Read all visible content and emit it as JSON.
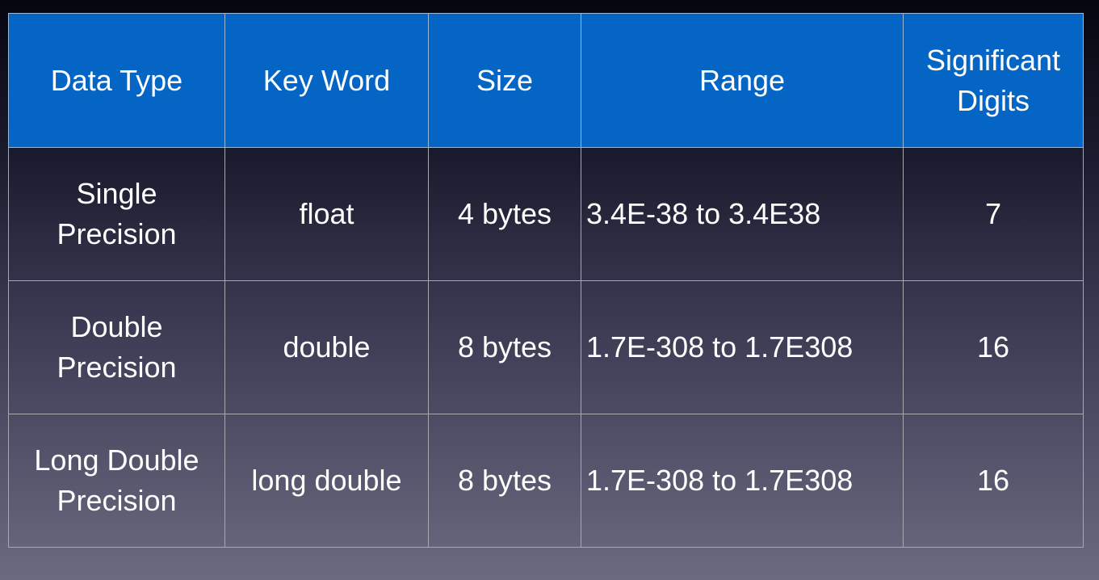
{
  "table": {
    "headers": [
      "Data Type",
      "Key Word",
      "Size",
      "Range",
      "Significant\nDigits"
    ],
    "rows": [
      [
        "Single\nPrecision",
        "float",
        "4 bytes",
        "3.4E-38 to 3.4E38",
        "7"
      ],
      [
        "Double\nPrecision",
        "double",
        "8 bytes",
        "1.7E-308 to 1.7E308",
        "16"
      ],
      [
        "Long Double\nPrecision",
        "long double",
        "8 bytes",
        "1.7E-308 to 1.7E308",
        "16"
      ]
    ]
  }
}
